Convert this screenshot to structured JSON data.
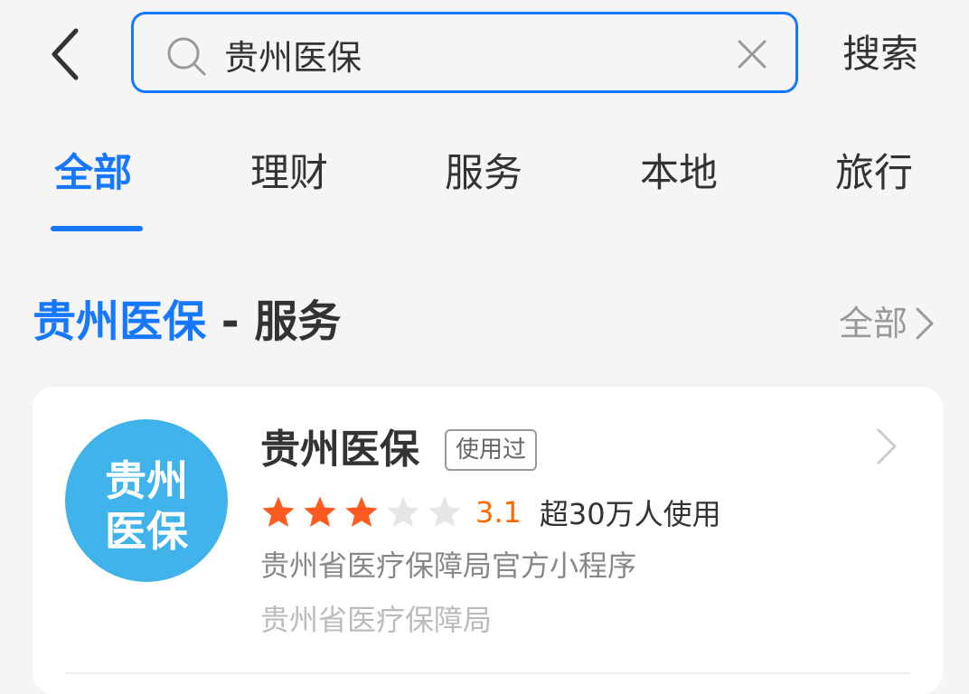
{
  "header": {
    "back_icon": "chevron-left-icon",
    "search": {
      "value": "贵州医保",
      "icon": "search-icon",
      "clear_icon": "close-icon",
      "border_color": "#1677ff"
    },
    "search_button_label": "搜索"
  },
  "tabs": [
    {
      "label": "全部",
      "active": true
    },
    {
      "label": "理财",
      "active": false
    },
    {
      "label": "服务",
      "active": false
    },
    {
      "label": "本地",
      "active": false
    },
    {
      "label": "旅行",
      "active": false
    }
  ],
  "section": {
    "title_keyword": "贵州医保",
    "title_rest": " - 服务",
    "more_label": "全部",
    "more_icon": "chevron-right-icon"
  },
  "result": {
    "name": "贵州医保",
    "used_tag": "使用过",
    "logo_text": "贵州医保",
    "logo_color": "#40b3ea",
    "rating": 3.1,
    "rating_display": "3.1",
    "stars_filled": 3,
    "stars_total": 5,
    "users": "超30万人使用",
    "description": "贵州省医疗保障局官方小程序",
    "provider": "贵州省医疗保障局",
    "arrow_icon": "chevron-right-icon"
  },
  "colors": {
    "accent": "#1677ff",
    "star_filled": "#ff5a1f",
    "star_empty": "#e6e6e6",
    "rating_text": "#ff6a00",
    "background": "#f5f5f5"
  }
}
